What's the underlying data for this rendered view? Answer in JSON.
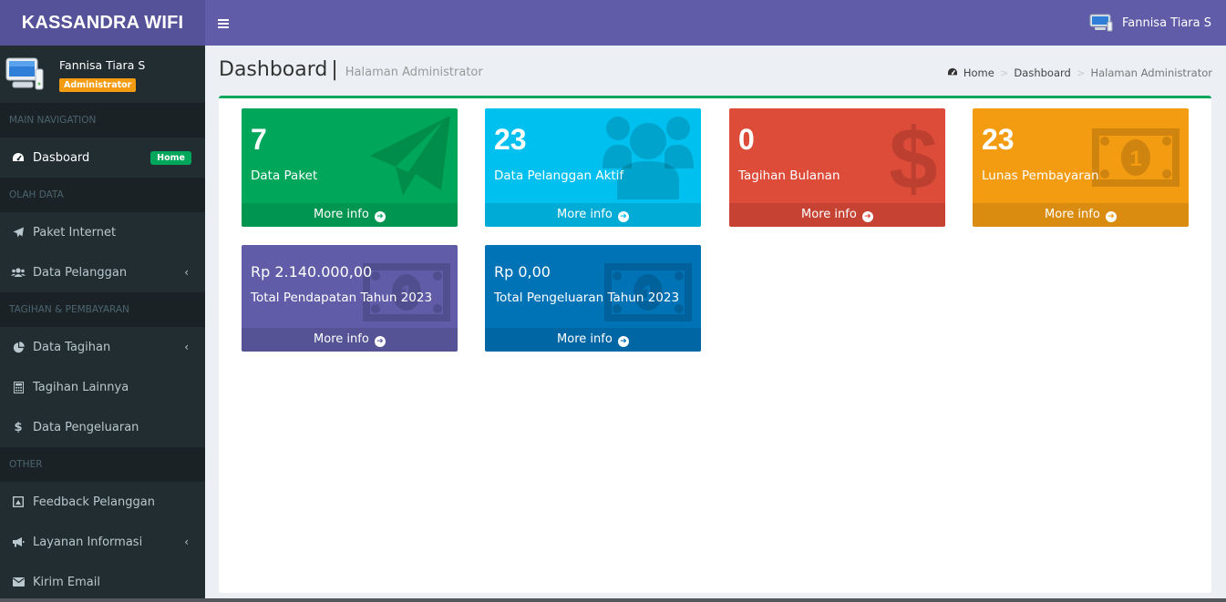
{
  "app": {
    "brand": "KASSANDRA WIFI"
  },
  "header": {
    "menu_icon": "hamburger-icon",
    "user_name": "Fannisa Tiara S"
  },
  "sidebar": {
    "user": {
      "name": "Fannisa Tiara S",
      "role": "Administrator"
    },
    "sections": [
      {
        "title": "MAIN NAVIGATION"
      },
      {
        "title": "OLAH DATA"
      },
      {
        "title": "TAGIHAN & PEMBAYARAN"
      },
      {
        "title": "OTHER"
      }
    ],
    "items": [
      {
        "label": "Dasboard",
        "icon": "dashboard-icon",
        "badge": "Home"
      },
      {
        "label": "Paket Internet",
        "icon": "paper-plane-icon"
      },
      {
        "label": "Data Pelanggan",
        "icon": "users-icon"
      },
      {
        "label": "Data Tagihan",
        "icon": "pie-chart-icon"
      },
      {
        "label": "Tagihan Lainnya",
        "icon": "calculator-icon"
      },
      {
        "label": "Data Pengeluaran",
        "icon": "dollar-icon"
      },
      {
        "label": "Feedback Pelanggan",
        "icon": "feedback-icon"
      },
      {
        "label": "Layanan Informasi",
        "icon": "bullhorn-icon"
      },
      {
        "label": "Kirim Email",
        "icon": "envelope-icon"
      }
    ],
    "chevron": "‹"
  },
  "content": {
    "title": "Dashboard",
    "separator": "|",
    "subtitle": "Halaman Administrator",
    "breadcrumb": [
      "Home",
      "Dashboard",
      "Halaman Administrator"
    ],
    "breadcrumb_sep": ">"
  },
  "cards": [
    {
      "value": "7",
      "label": "Data Paket",
      "more": "More info",
      "color": "#00a65a",
      "icon": "paper-plane-icon"
    },
    {
      "value": "23",
      "label": "Data Pelanggan Aktif",
      "more": "More info",
      "color": "#00c0ef",
      "icon": "users-icon"
    },
    {
      "value": "0",
      "label": "Tagihan Bulanan",
      "more": "More info",
      "color": "#dd4b39",
      "icon": "dollar-icon"
    },
    {
      "value": "23",
      "label": "Lunas Pembayaran",
      "more": "More info",
      "color": "#f39c12",
      "icon": "money-icon"
    },
    {
      "value": "Rp 2.140.000,00",
      "label": "Total Pendapatan Tahun 2023",
      "more": "More info",
      "color": "#605ca8",
      "icon": "money-icon"
    },
    {
      "value": "Rp 0,00",
      "label": "Total Pengeluaran Tahun 2023",
      "more": "More info",
      "color": "#0073b7",
      "icon": "money-icon"
    }
  ]
}
